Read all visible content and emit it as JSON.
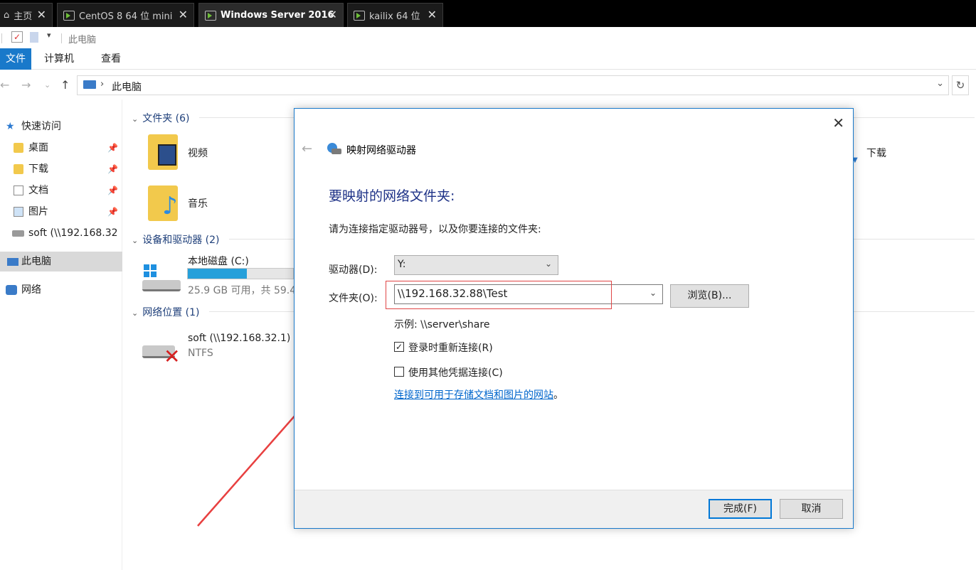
{
  "vm_tabs": [
    {
      "label": "主页"
    },
    {
      "label": "CentOS 8 64 位 mini"
    },
    {
      "label": "Windows Server 2016"
    },
    {
      "label": "kailix 64 位"
    }
  ],
  "tab_close_glyph": "✕",
  "qat": {
    "title": "此电脑"
  },
  "ribbon": {
    "file": "文件",
    "computer": "计算机",
    "view": "查看"
  },
  "address": {
    "crumb": "此电脑"
  },
  "nav": {
    "quick_access": "快速访问",
    "desktop": "桌面",
    "downloads": "下载",
    "documents": "文档",
    "pictures": "图片",
    "soft": "soft (\\\\192.168.32",
    "this_pc": "此电脑",
    "network": "网络"
  },
  "content": {
    "folders_header": "文件夹 (6)",
    "videos": "视频",
    "music": "音乐",
    "downloads_partial": "下载",
    "devices_header": "设备和驱动器 (2)",
    "local_disk": "本地磁盘 (C:)",
    "disk_space": "25.9 GB 可用，共 59.4",
    "disk_usage": 0.56,
    "netloc_header": "网络位置 (1)",
    "soft_share": "soft (\\\\192.168.32.1)",
    "soft_fs": "NTFS"
  },
  "dialog": {
    "title": "映射网络驱动器",
    "heading": "要映射的网络文件夹:",
    "description": "请为连接指定驱动器号，以及你要连接的文件夹:",
    "drive_label": "驱动器(D):",
    "drive_value": "Y:",
    "folder_label": "文件夹(O):",
    "folder_value": "\\\\192.168.32.88\\Test",
    "browse": "浏览(B)...",
    "example": "示例: \\\\server\\share",
    "reconnect_label": "登录时重新连接(R)",
    "reconnect_checked": true,
    "other_creds_label": "使用其他凭据连接(C)",
    "other_creds_checked": false,
    "link": "连接到可用于存储文档和图片的网站",
    "link_suffix": "。",
    "finish": "完成(F)",
    "cancel": "取消"
  },
  "colors": {
    "accent": "#1979ca",
    "highlight_box": "#e04545",
    "arrow": "#e84040"
  }
}
